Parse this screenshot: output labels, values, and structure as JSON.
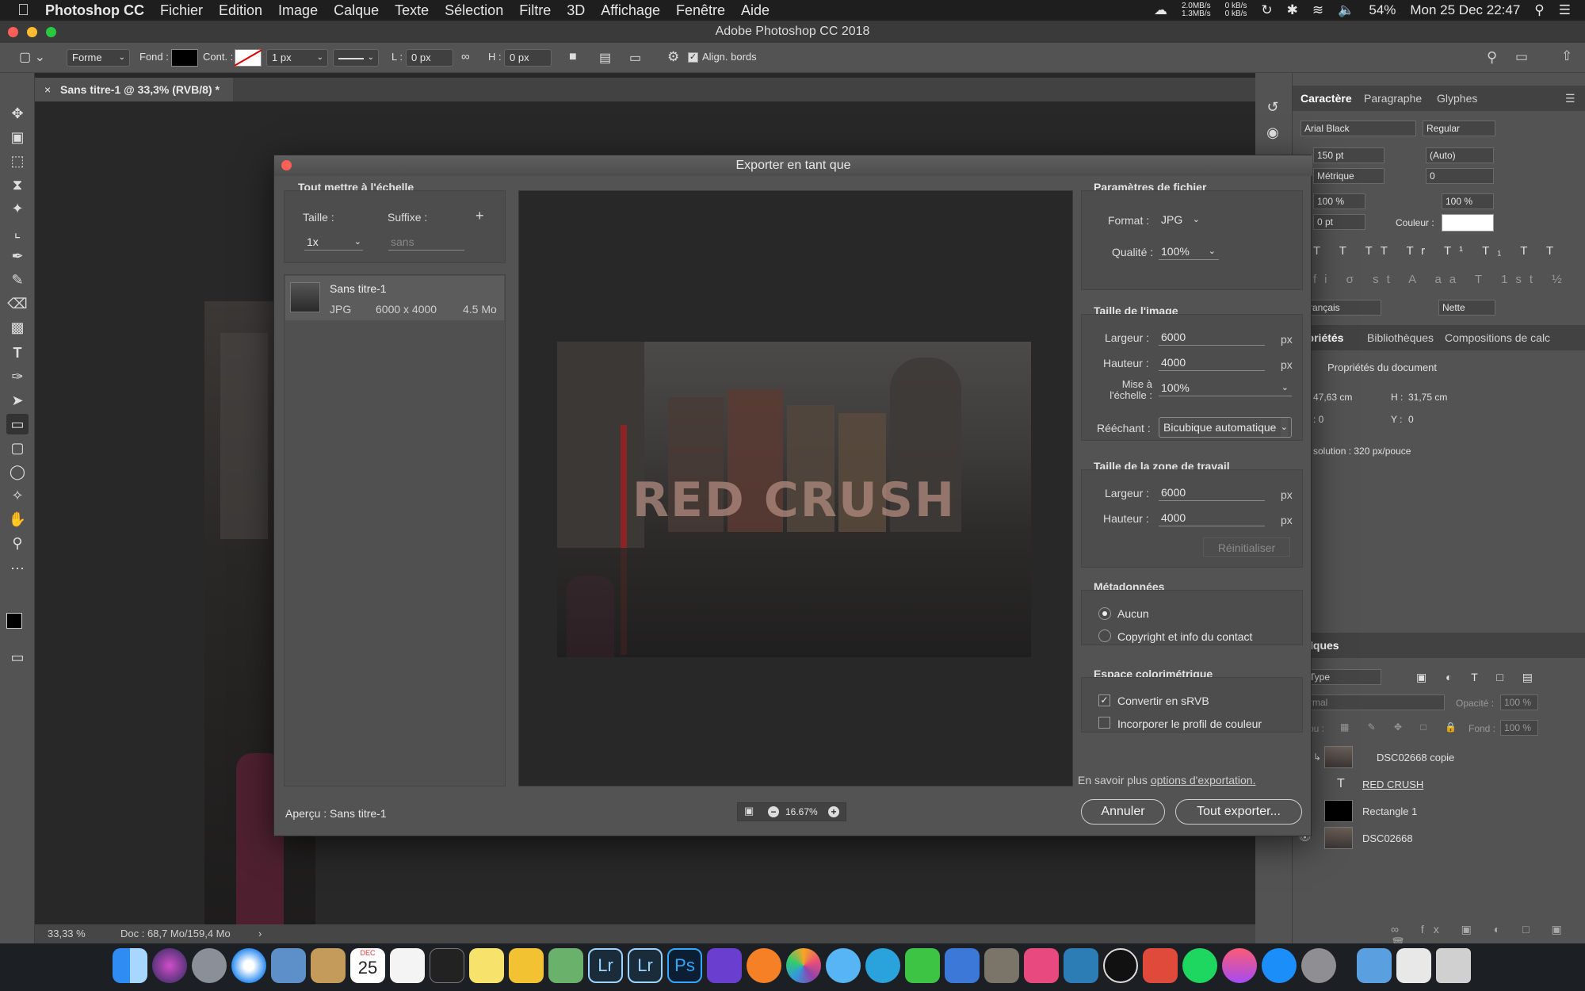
{
  "menubar": {
    "app": "Photoshop CC",
    "items": [
      "Fichier",
      "Edition",
      "Image",
      "Calque",
      "Texte",
      "Sélection",
      "Filtre",
      "3D",
      "Affichage",
      "Fenêtre",
      "Aide"
    ],
    "net_up": "2.0MB/s",
    "net_down": "1.3MB/s",
    "net2_up": "0 kB/s",
    "net2_down": "0 kB/s",
    "battery": "54%",
    "clock": "Mon 25 Dec  22:47"
  },
  "window_title": "Adobe Photoshop CC 2018",
  "options": {
    "mode": "Forme",
    "fill_label": "Fond :",
    "stroke_label": "Cont. :",
    "stroke_width": "1 px",
    "w_label": "L :",
    "w_value": "0 px",
    "h_label": "H :",
    "h_value": "0 px",
    "align_edges": "Align. bords"
  },
  "document": {
    "tab": "Sans titre-1 @ 33,3% (RVB/8) *",
    "zoom": "33,33 %",
    "doc_info": "Doc : 68,7 Mo/159,4 Mo"
  },
  "dialog": {
    "title": "Exporter en tant que",
    "scale_all": "Tout mettre à l'échelle",
    "size_label": "Taille :",
    "suffix_label": "Suffixe :",
    "size_value": "1x",
    "suffix_placeholder": "sans",
    "asset": {
      "name": "Sans titre-1",
      "format": "JPG",
      "dims": "6000 x 4000",
      "filesize": "4.5 Mo"
    },
    "preview_overlay_text": "RED CRUSH",
    "file_settings": "Paramètres de fichier",
    "format_label": "Format :",
    "format_value": "JPG",
    "quality_label": "Qualité :",
    "quality_value": "100%",
    "image_size": "Taille de l'image",
    "width_label": "Largeur :",
    "width_value": "6000",
    "height_label": "Hauteur :",
    "height_value": "4000",
    "scale_label_1": "Mise à",
    "scale_label_2": "l'échelle :",
    "scale_value": "100%",
    "resample_label": "Rééchant :",
    "resample_value": "Bicubique automatique",
    "unit_px": "px",
    "canvas_size": "Taille de la zone de travail",
    "canvas_width": "6000",
    "canvas_height": "4000",
    "reset": "Réinitialiser",
    "metadata": "Métadonnées",
    "meta_none": "Aucun",
    "meta_copyright": "Copyright et info du contact",
    "color_space": "Espace colorimétrique",
    "convert_srgb": "Convertir en sRVB",
    "embed_profile": "Incorporer le profil de couleur",
    "learn_more": "En savoir plus",
    "learn_more_link": "options d'exportation.",
    "preview_label": "Aperçu : Sans titre-1",
    "zoom": "16.67%",
    "cancel": "Annuler",
    "export_all": "Tout exporter..."
  },
  "panels": {
    "char_tabs": [
      "Caractère",
      "Paragraphe",
      "Glyphes"
    ],
    "font": "Arial Black",
    "style": "Regular",
    "size": "150 pt",
    "leading": "(Auto)",
    "kerning": "Métrique",
    "tracking": "0",
    "vscale": "100 %",
    "hscale": "100 %",
    "baseline": "0 pt",
    "color_label": "Couleur :",
    "language": "rançais",
    "antialias": "Nette",
    "props_tabs": [
      "opriétés",
      "Bibliothèques",
      "Compositions de calc"
    ],
    "doc_props": "Propriétés du document",
    "l_value": "47,63 cm",
    "h_label": "H :",
    "h_value": "31,75 cm",
    "x_value": ": 0",
    "y_label": "Y :",
    "y_value": "0",
    "resolution": "solution : 320 px/pouce",
    "layers_tab": "lques",
    "layer_filter": "Type",
    "blend": "rmal",
    "opacity_label": "Opacité :",
    "opacity_value": "100 %",
    "lock_label": "rou :",
    "fill_label": "Fond :",
    "fill_value": "100 %",
    "layers": [
      "DSC02668 copie",
      "RED CRUSH",
      "Rectangle 1",
      "DSC02668"
    ]
  },
  "dock": {
    "calendar_month": "DEC",
    "calendar_day": "25"
  }
}
